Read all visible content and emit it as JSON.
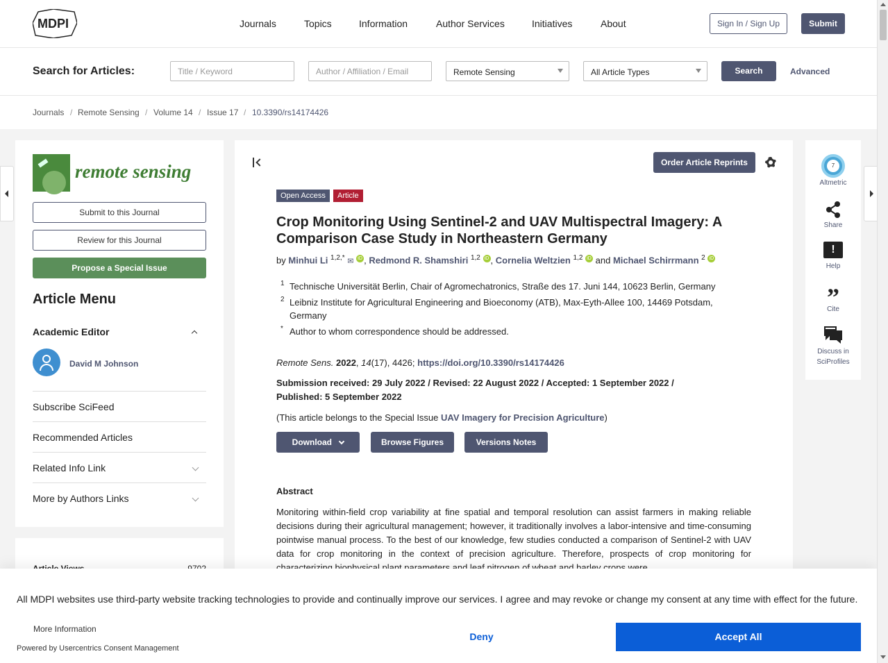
{
  "header": {
    "logo_text": "MDPI",
    "nav": [
      "Journals",
      "Topics",
      "Information",
      "Author Services",
      "Initiatives",
      "About"
    ],
    "signin": "Sign In / Sign Up",
    "submit": "Submit"
  },
  "search": {
    "label": "Search for Articles:",
    "title_placeholder": "Title / Keyword",
    "author_placeholder": "Author / Affiliation / Email",
    "journal_selected": "Remote Sensing",
    "type_selected": "All Article Types",
    "button": "Search",
    "advanced": "Advanced"
  },
  "breadcrumb": [
    "Journals",
    "Remote Sensing",
    "Volume 14",
    "Issue 17",
    "10.3390/rs14174426"
  ],
  "sidebar": {
    "journal_name": "remote sensing",
    "submit_journal": "Submit to this Journal",
    "review_journal": "Review for this Journal",
    "propose_issue": "Propose a Special Issue",
    "article_menu": "Article Menu",
    "academic_editor": "Academic Editor",
    "editor_name": "David M Johnson",
    "items": [
      "Subscribe SciFeed",
      "Recommended Articles",
      "Related Info Link",
      "More by Authors Links"
    ],
    "views_label": "Article Views",
    "views_value": "9702"
  },
  "article": {
    "order_reprints": "Order Article Reprints",
    "tag_open": "Open Access",
    "tag_article": "Article",
    "title": "Crop Monitoring Using Sentinel-2 and UAV Multispectral Imagery: A Comparison Case Study in Northeastern Germany",
    "by": "by",
    "authors": [
      {
        "name": "Minhui Li",
        "sup": "1,2,*"
      },
      {
        "name": "Redmond R. Shamshiri",
        "sup": "1,2"
      },
      {
        "name": "Cornelia Weltzien",
        "sup": "1,2"
      },
      {
        "name": "Michael Schirrmann",
        "sup": "2"
      }
    ],
    "and": "and",
    "affiliations": [
      {
        "mark": "1",
        "text": "Technische Universität Berlin, Chair of Agromechatronics, Straße des 17. Juni 144, 10623 Berlin, Germany"
      },
      {
        "mark": "2",
        "text": "Leibniz Institute for Agricultural Engineering and Bioeconomy (ATB), Max-Eyth-Allee 100, 14469 Potsdam, Germany"
      },
      {
        "mark": "*",
        "text": "Author to whom correspondence should be addressed."
      }
    ],
    "journal_abbr": "Remote Sens.",
    "year": "2022",
    "volume": "14",
    "issue_pages": "(17), 4426;",
    "doi": "https://doi.org/10.3390/rs14174426",
    "dates": "Submission received: 29 July 2022 / Revised: 22 August 2022 / Accepted: 1 September 2022 / Published: 5 September 2022",
    "special_issue_prefix": "(This article belongs to the Special Issue",
    "special_issue": "UAV Imagery for Precision Agriculture",
    "special_issue_suffix": ")",
    "download": "Download",
    "browse_figures": "Browse Figures",
    "versions_notes": "Versions Notes",
    "abstract_heading": "Abstract",
    "abstract": "Monitoring within-field crop variability at fine spatial and temporal resolution can assist farmers in making reliable decisions during their agricultural management; however, it traditionally involves a labor-intensive and time-consuming pointwise manual process. To the best of our knowledge, few studies conducted a comparison of Sentinel-2 with UAV data for crop monitoring in the context of precision agriculture. Therefore, prospects of crop monitoring for characterizing biophysical plant parameters and leaf nitrogen of wheat and barley crops were"
  },
  "right_tools": {
    "altmetric_score": "7",
    "altmetric": "Altmetric",
    "share": "Share",
    "help": "Help",
    "cite": "Cite",
    "discuss": "Discuss in SciProfiles"
  },
  "cookie": {
    "text": "All MDPI websites use third-party website tracking technologies to provide and continually improve our services. I agree and may revoke or change my consent at any time with effect for the future.",
    "more": "More Information",
    "deny": "Deny",
    "accept": "Accept All",
    "powered": "Powered by Usercentrics Consent Management"
  },
  "colors": {
    "accent": "#4f5671",
    "green": "#5b8f5a",
    "accept": "#0b5ed7",
    "tag_red": "#b11e33"
  }
}
